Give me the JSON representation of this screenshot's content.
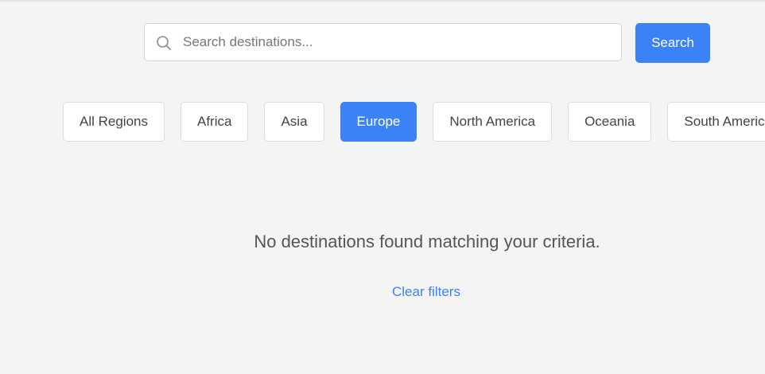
{
  "search": {
    "placeholder": "Search destinations...",
    "value": "",
    "button_label": "Search"
  },
  "filters": {
    "selected": "Europe",
    "regions": [
      "All Regions",
      "Africa",
      "Asia",
      "Europe",
      "North America",
      "Oceania",
      "South America"
    ]
  },
  "results": {
    "empty_message": "No destinations found matching your criteria.",
    "clear_label": "Clear filters"
  },
  "colors": {
    "accent": "#3b82f6",
    "background": "#f4f4f4"
  },
  "icons": {
    "search": "search-icon"
  }
}
